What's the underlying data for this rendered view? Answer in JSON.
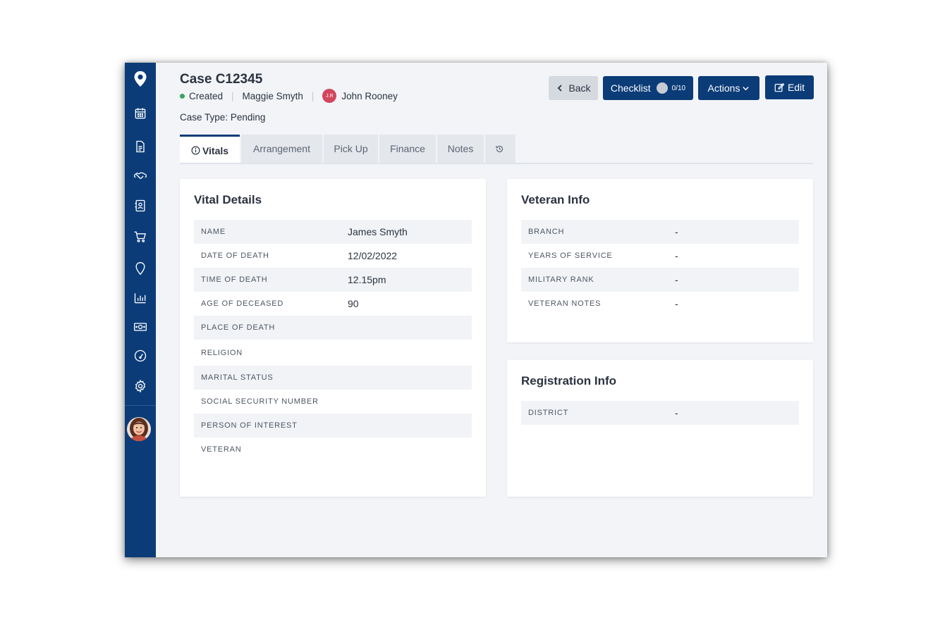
{
  "case": {
    "title": "Case C12345",
    "status": "Created",
    "owner": "Maggie Smyth",
    "assignee_initials": "J.R",
    "assignee": "John Rooney",
    "type_label": "Case Type:",
    "type_value": "Pending"
  },
  "toolbar": {
    "back_label": "Back",
    "checklist_label": "Checklist",
    "checklist_count": "0/10",
    "actions_label": "Actions",
    "edit_label": "Edit"
  },
  "tabs": [
    {
      "label": "Vitals",
      "active": true
    },
    {
      "label": "Arrangement"
    },
    {
      "label": "Pick Up"
    },
    {
      "label": "Finance"
    },
    {
      "label": "Notes"
    }
  ],
  "vital_details": {
    "title": "Vital Details",
    "rows": [
      {
        "label": "NAME",
        "value": "James Smyth"
      },
      {
        "label": "DATE OF DEATH",
        "value": "12/02/2022"
      },
      {
        "label": "TIME OF DEATH",
        "value": "12.15pm"
      },
      {
        "label": "AGE OF DECEASED",
        "value": "90"
      },
      {
        "label": "PLACE OF DEATH",
        "value": ""
      },
      {
        "label": "RELIGION",
        "value": ""
      },
      {
        "label": "MARITAL STATUS",
        "value": ""
      },
      {
        "label": "SOCIAL SECURITY NUMBER",
        "value": ""
      },
      {
        "label": "PERSON OF INTEREST",
        "value": ""
      },
      {
        "label": "VETERAN",
        "value": ""
      }
    ]
  },
  "veteran_info": {
    "title": "Veteran Info",
    "rows": [
      {
        "label": "BRANCH",
        "value": "-"
      },
      {
        "label": "YEARS OF SERVICE",
        "value": "-"
      },
      {
        "label": "MILITARY RANK",
        "value": "-"
      },
      {
        "label": "VETERAN NOTES",
        "value": "-"
      }
    ]
  },
  "registration_info": {
    "title": "Registration Info",
    "rows": [
      {
        "label": "DISTRICT",
        "value": "-"
      }
    ]
  },
  "sidebar": {
    "icons": [
      "location-pin-icon",
      "calendar-icon",
      "document-icon",
      "handshake-icon",
      "contacts-icon",
      "cart-icon",
      "map-pin-icon",
      "bar-chart-icon",
      "money-icon",
      "dashboard-gauge-icon",
      "settings-gear-icon"
    ]
  },
  "colors": {
    "sidebar": "#0b3c78",
    "primary_button": "#0b3c78",
    "status_dot": "#3aa35c",
    "avatar_badge": "#d2465c",
    "background": "#f2f4f8"
  }
}
